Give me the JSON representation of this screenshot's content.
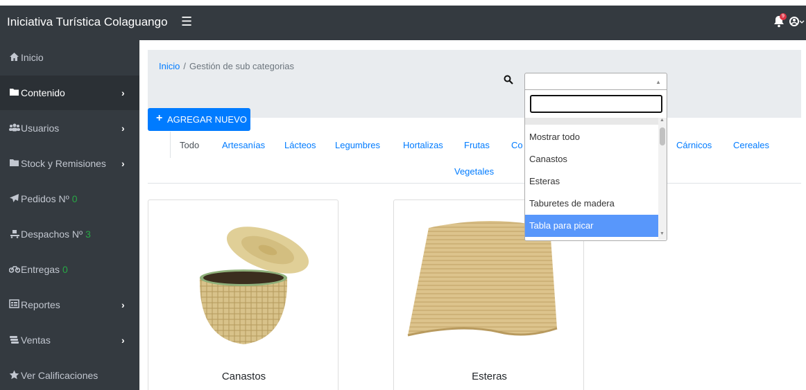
{
  "app": {
    "title": "Iniciativa Turística Colaguango",
    "menu_icon": "☰",
    "notifications_count": "9"
  },
  "sidebar": {
    "items": [
      {
        "label": "Inicio",
        "icon": "home-icon",
        "count": ""
      },
      {
        "label": "Contenido",
        "icon": "folder-icon",
        "count": ""
      },
      {
        "label": "Usuarios",
        "icon": "users-icon",
        "count": ""
      },
      {
        "label": "Stock y Remisiones",
        "icon": "folder-icon",
        "count": ""
      },
      {
        "label": "Pedidos Nº",
        "icon": "send-icon",
        "count": "0"
      },
      {
        "label": "Despachos Nº",
        "icon": "dolly-icon",
        "count": "3"
      },
      {
        "label": "Entregas",
        "icon": "motorcycle-icon",
        "count": "0"
      },
      {
        "label": "Reportes",
        "icon": "report-icon",
        "count": ""
      },
      {
        "label": "Ventas",
        "icon": "money-icon",
        "count": ""
      },
      {
        "label": "Ver Calificaciones",
        "icon": "star-icon",
        "count": ""
      }
    ]
  },
  "breadcrumb": {
    "home": "Inicio",
    "separator": "/",
    "current": "Gestión de sub categorias"
  },
  "toolbar": {
    "add_label": "AGREGAR NUEVO"
  },
  "tabs": [
    {
      "label": "Todo"
    },
    {
      "label": "Artesanías"
    },
    {
      "label": "Lácteos"
    },
    {
      "label": "Legumbres"
    },
    {
      "label": "Hortalizas"
    },
    {
      "label": "Frutas"
    },
    {
      "label": "Co"
    },
    {
      "label": "Cárnicos"
    },
    {
      "label": "Cereales"
    },
    {
      "label": "Vegetales"
    }
  ],
  "products": [
    {
      "title": "Canastos"
    },
    {
      "title": "Esteras"
    }
  ],
  "dropdown": {
    "options": [
      "Mostrar todo",
      "Canastos",
      "Esteras",
      "Taburetes de madera",
      "Tabla para picar"
    ],
    "selected": "Tabla para picar"
  },
  "colors": {
    "navbar": "#343a40",
    "accent": "#007bff",
    "selected_option": "#5897fb",
    "count": "#28a745"
  }
}
